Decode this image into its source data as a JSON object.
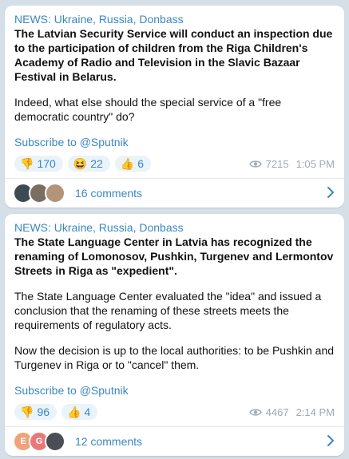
{
  "posts": [
    {
      "channel": "NEWS: Ukraine, Russia, Donbass",
      "headline": "The Latvian Security Service will conduct an inspection due to the participation of children from the Riga Children's Academy of Radio and Television in the Slavic Bazaar Festival in Belarus.",
      "paragraphs": [
        "Indeed, what else should the special service of a \"free democratic country\" do?"
      ],
      "subscribe": "Subscribe to @Sputnik",
      "reactions": [
        {
          "icon": "thumbs-down-icon",
          "emoji": "👎",
          "count": "170"
        },
        {
          "icon": "grinning-face-icon",
          "emoji": "😆",
          "count": "22"
        },
        {
          "icon": "thumbs-up-icon",
          "emoji": "👍",
          "count": "6"
        }
      ],
      "views": "7215",
      "time": "1:05 PM",
      "comments": {
        "label": "16 comments",
        "avatars": [
          {
            "initial": "",
            "color": "#3d4a52"
          },
          {
            "initial": "",
            "color": "#7a6d62"
          },
          {
            "initial": "",
            "color": "#b49478"
          }
        ]
      }
    },
    {
      "channel": "NEWS: Ukraine, Russia, Donbass",
      "headline": "The State Language Center in Latvia has recognized the renaming of Lomonosov, Pushkin, Turgenev and Lermontov Streets in Riga as \"expedient\".",
      "paragraphs": [
        "The State Language Center evaluated the \"idea\" and issued a conclusion that the renaming of these streets meets the requirements of regulatory acts.",
        "Now the decision is up to the local authorities: to be Pushkin and Turgenev in Riga or to \"cancel\" them."
      ],
      "subscribe": "Subscribe to @Sputnik",
      "reactions": [
        {
          "icon": "thumbs-down-icon",
          "emoji": "👎",
          "count": "96"
        },
        {
          "icon": "thumbs-up-icon",
          "emoji": "👍",
          "count": "4"
        }
      ],
      "views": "4467",
      "time": "2:14 PM",
      "comments": {
        "label": "12 comments",
        "avatars": [
          {
            "initial": "E",
            "color": "#f0a27a"
          },
          {
            "initial": "G",
            "color": "#e8787a"
          },
          {
            "initial": "",
            "color": "#4a4f55"
          }
        ]
      }
    }
  ],
  "colors": {
    "link": "#3a87c4",
    "background": "#d5dfe7",
    "reaction_bg": "#eaf2fa",
    "meta": "#a0a8b0"
  }
}
